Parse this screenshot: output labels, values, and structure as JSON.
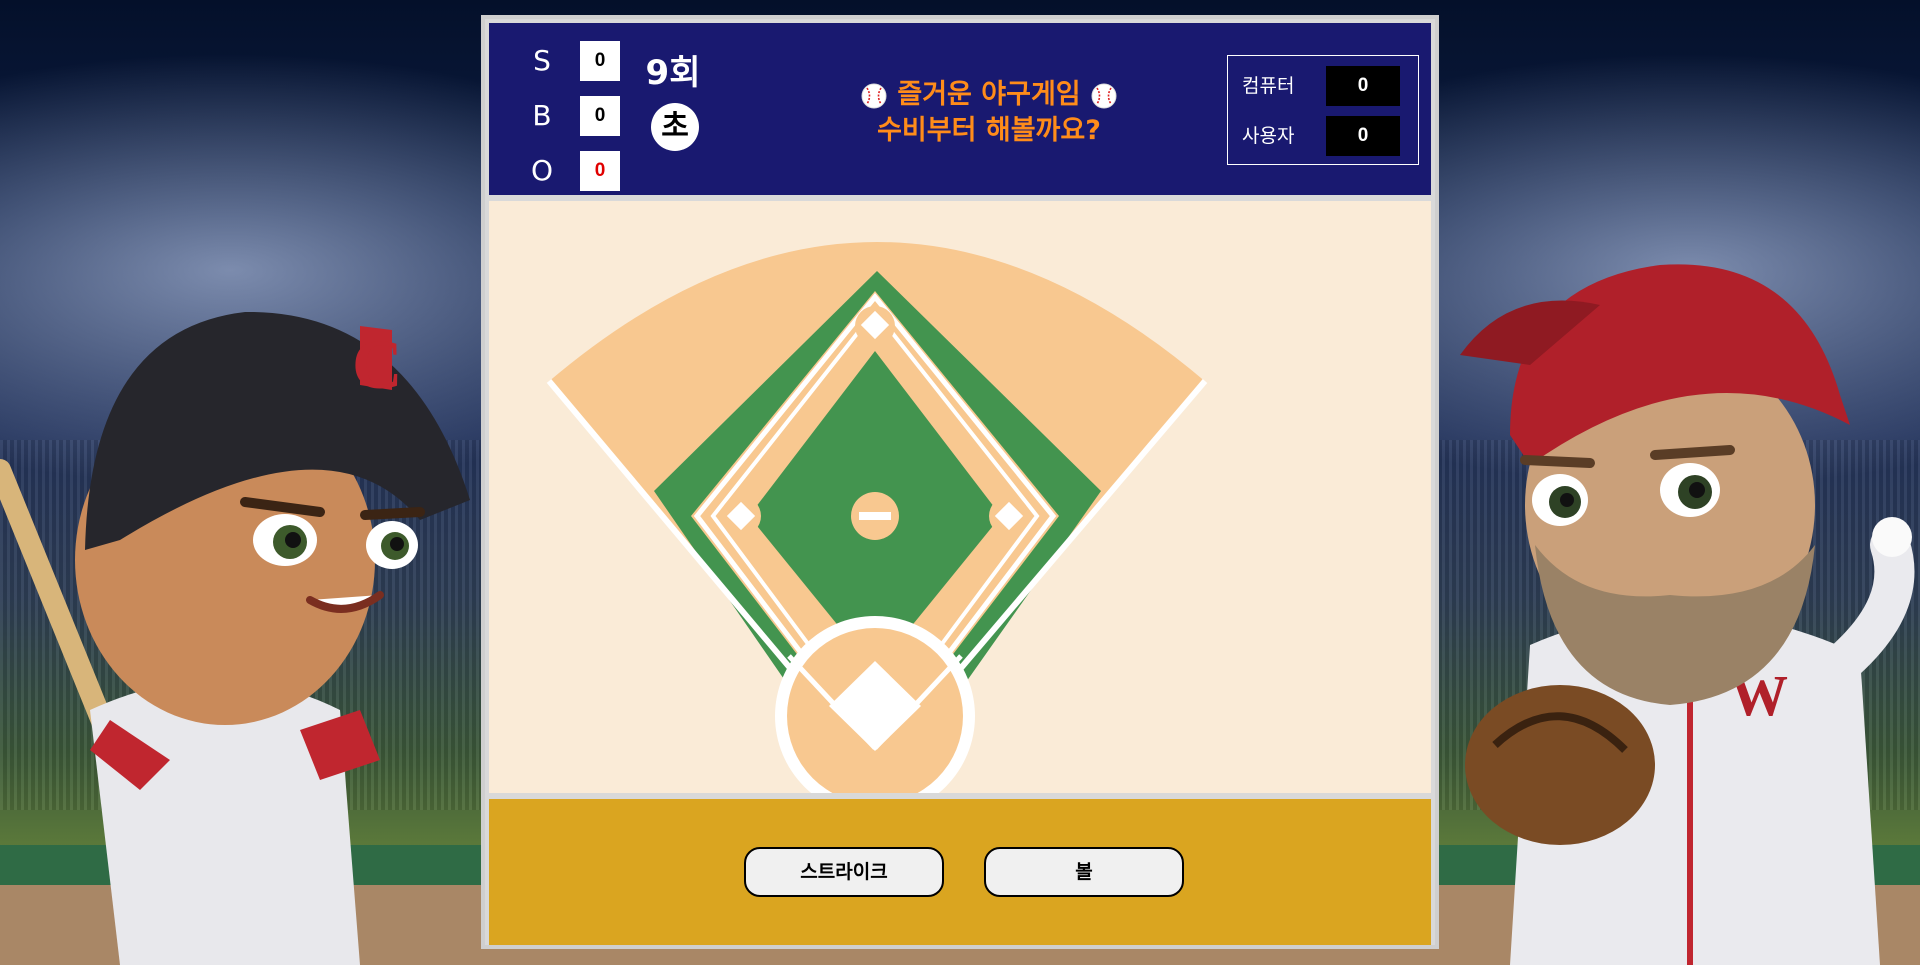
{
  "scoreboard": {
    "count": [
      {
        "label": "S",
        "value": "0"
      },
      {
        "label": "B",
        "value": "0"
      },
      {
        "label": "O",
        "value": "0"
      }
    ],
    "inning": "9회",
    "half": "초",
    "title_line1": "즐거운 야구게임",
    "title_line2": "수비부터 해볼까요?",
    "scores": [
      {
        "label": "컴퓨터",
        "value": "0"
      },
      {
        "label": "사용자",
        "value": "0"
      }
    ]
  },
  "controls": {
    "strike_label": "스트라이크",
    "ball_label": "볼"
  },
  "colors": {
    "scoreboard_bg": "#191970",
    "title": "#ff8c1a",
    "out_count": "#e00000",
    "field_bg": "#faebd7",
    "dirt": "#f8c890",
    "grass": "#43944f",
    "controls_bg": "#daa520"
  },
  "icons": [
    "baseball-icon",
    "baseball-icon"
  ]
}
